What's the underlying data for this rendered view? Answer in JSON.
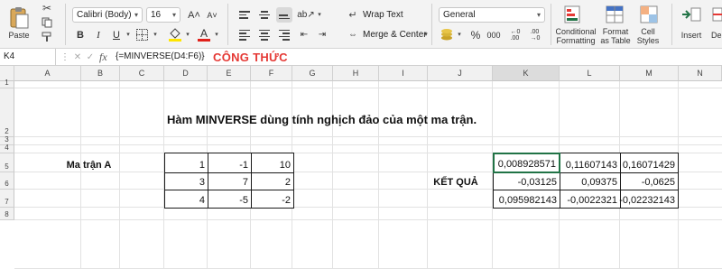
{
  "ribbon": {
    "paste_label": "Paste",
    "font_name": "Calibri (Body)",
    "font_size": "16",
    "grow_font": "A˄",
    "shrink_font": "A˅",
    "bold": "B",
    "italic": "I",
    "underline": "U",
    "wrap_text": "Wrap Text",
    "merge_center": "Merge & Center",
    "number_format": "General",
    "conditional_formatting": [
      "Conditional",
      "Formatting"
    ],
    "format_as_table": [
      "Format",
      "as Table"
    ],
    "cell_styles": [
      "Cell",
      "Styles"
    ],
    "insert": "Insert",
    "delete": "De",
    "accent_color": "#217346",
    "font_color": "#e0211b",
    "highlight_color": "#ffe500"
  },
  "formula_bar": {
    "name_box": "K4",
    "fx": "fx",
    "formula": "{=MINVERSE(D4:F6)}",
    "annotation": "CÔNG THỨC"
  },
  "columns": [
    "A",
    "B",
    "C",
    "D",
    "E",
    "F",
    "G",
    "H",
    "I",
    "J",
    "K",
    "L",
    "M",
    "N"
  ],
  "rows": [
    "1",
    "2",
    "3",
    "4",
    "5",
    "6",
    "7",
    "8"
  ],
  "sheet": {
    "title": "Hàm MINVERSE dùng tính nghịch đảo của một ma trận.",
    "matrix_label": "Ma trận A",
    "matrix": [
      [
        "1",
        "-1",
        "10"
      ],
      [
        "3",
        "7",
        "2"
      ],
      [
        "4",
        "-5",
        "-2"
      ]
    ],
    "result_label": "KẾT QUẢ",
    "result": [
      [
        "0,008928571",
        "0,11607143",
        "0,16071429"
      ],
      [
        "-0,03125",
        "0,09375",
        "-0,0625"
      ],
      [
        "0,095982143",
        "-0,0022321",
        "-0,02232143"
      ]
    ]
  }
}
